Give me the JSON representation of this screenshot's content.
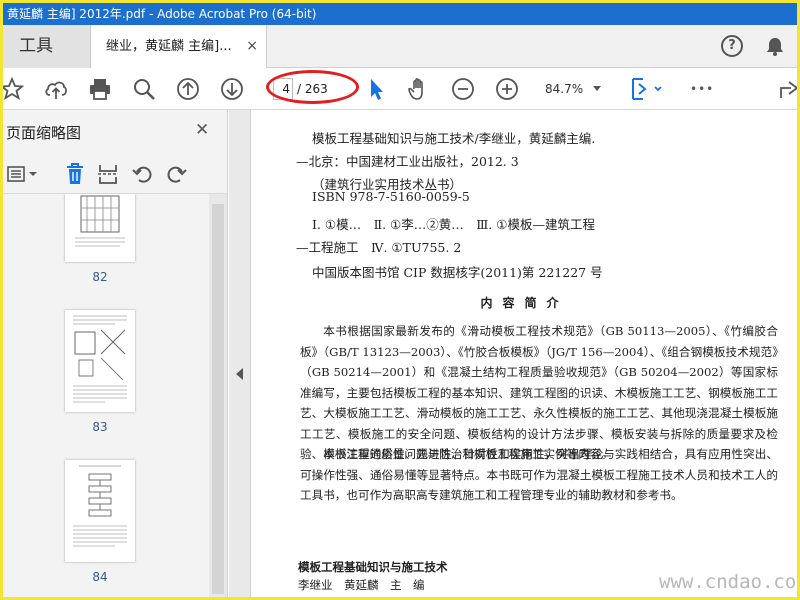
{
  "window": {
    "title": "黄延麟 主编] 2012年.pdf - Adobe Acrobat Pro (64-bit)"
  },
  "tabs": {
    "tools_label": "工具",
    "document_tab": "继业，黄延麟 主编]...",
    "close_glyph": "×"
  },
  "toolbar": {
    "current_page": "4",
    "page_total": "/ 263",
    "zoom": "84.7%",
    "more_glyph": "•••"
  },
  "thumbnail_panel": {
    "title": "页面缩略图",
    "close_glyph": "✕",
    "pages": [
      {
        "label": "82"
      },
      {
        "label": "83"
      },
      {
        "label": "84"
      }
    ]
  },
  "document": {
    "cip_lines": [
      "模板工程基础知识与施工技术/李继业，黄延麟主编.",
      "—北京：中国建材工业出版社，2012. 3",
      "（建筑行业实用技术丛书）",
      "ISBN 978-7-5160-0059-5",
      "Ⅰ. ①模…　Ⅱ. ①李…②黄…　Ⅲ. ①模板—建筑工程",
      "—工程施工　Ⅳ. ①TU755. 2",
      "中国版本图书馆 CIP 数据核字(2011)第 221227 号"
    ],
    "description_title": "内容简介",
    "paragraph_1": "本书根据国家最新发布的《滑动模板工程技术规范》（GB 50113—2005）、《竹编胶合板》（GB/T 13123—2003）、《竹胶合板模板》（JG/T 156—2004）、《组合钢模板技术规范》（GB 50214—2001）和《混凝土结构工程质量验收规范》（GB 50204—2002）等国家标准编写，主要包括模板工程的基本知识、建筑工程图的识读、木模板施工工艺、钢模板施工工艺、大模板施工工艺、滑动模板的施工工艺、永久性模板的施工工艺、其他现浇混凝土模板施工工艺、模板施工的安全问题、模板结构的设计方法步骤、模板安装与拆除的质量要求及检验、模板工程的质量问题与防治和模板工程施工实例等内容。",
    "paragraph_2": "本书注重通俗性、先进性、针对性和实用性，突出理论与实践相结合，具有应用性突出、可操作性强、通俗易懂等显著特点。本书既可作为混凝土模板工程施工技术人员和技术工人的工具书，也可作为高职高专建筑施工和工程管理专业的辅助教材和参考书。",
    "credit_title": "模板工程基础知识与施工技术",
    "credit_authors": "李继业　黄延麟　主　编"
  },
  "watermark": "www.cndao.com",
  "colors": {
    "titlebar": "#1d6fcf",
    "accent_blue": "#1473e6",
    "highlight_red": "#e02020",
    "frame_yellow": "#f2e534"
  }
}
